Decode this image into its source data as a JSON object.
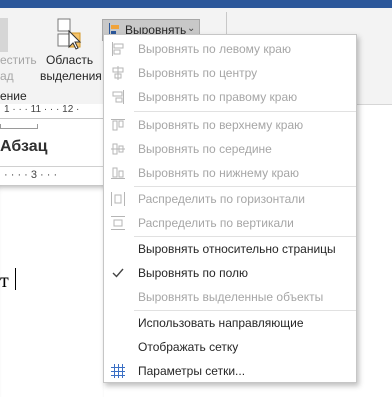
{
  "ribbon": {
    "move_line1": "естить",
    "move_line2": "ад",
    "selection_pane_line1": "Область",
    "selection_pane_line2": "выделения",
    "group_name": "ение",
    "align_button_label": "Выровнять"
  },
  "ruler_top": {
    "ticks": "1 · · · 11 · · · 12 ·"
  },
  "paragraph_group": "Абзац",
  "ruler_mid": {
    "ticks": "· · · · 3 · · ·"
  },
  "document": {
    "text": "т"
  },
  "menu": {
    "items": [
      {
        "label": "Выровнять по левому краю",
        "enabled": false,
        "icon": "align-left-icon"
      },
      {
        "label": "Выровнять по центру",
        "enabled": false,
        "icon": "align-center-icon"
      },
      {
        "label": "Выровнять по правому краю",
        "enabled": false,
        "icon": "align-right-icon"
      },
      {
        "label": "Выровнять по верхнему краю",
        "enabled": false,
        "icon": "align-top-icon"
      },
      {
        "label": "Выровнять по середине",
        "enabled": false,
        "icon": "align-middle-icon"
      },
      {
        "label": "Выровнять по нижнему краю",
        "enabled": false,
        "icon": "align-bottom-icon"
      },
      {
        "label": "Распределить по горизонтали",
        "enabled": false,
        "icon": "distribute-horizontal-icon"
      },
      {
        "label": "Распределить по вертикали",
        "enabled": false,
        "icon": "distribute-vertical-icon"
      },
      {
        "label": "Выровнять относительно страницы",
        "enabled": true,
        "icon": ""
      },
      {
        "label": "Выровнять по полю",
        "enabled": true,
        "icon": "checkmark-icon"
      },
      {
        "label": "Выровнять выделенные объекты",
        "enabled": false,
        "icon": ""
      },
      {
        "label": "Использовать направляющие",
        "enabled": true,
        "icon": ""
      },
      {
        "label": "Отображать сетку",
        "enabled": true,
        "icon": ""
      },
      {
        "label": "Параметры сетки...",
        "enabled": true,
        "icon": "grid-icon"
      }
    ]
  },
  "colors": {
    "accent": "#2b579a",
    "disabled_text": "#a6a6a6",
    "grid_icon": "#3a6fc4"
  }
}
